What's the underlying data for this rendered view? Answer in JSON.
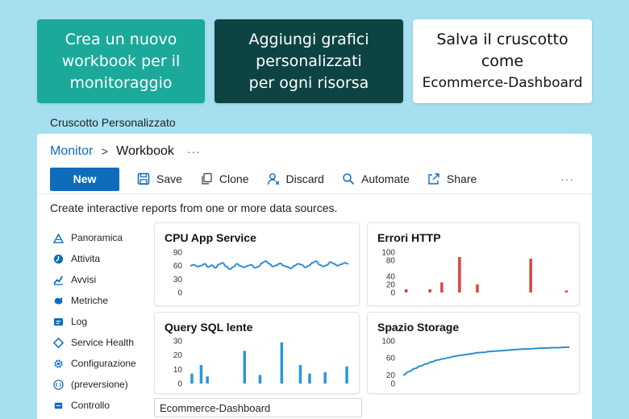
{
  "steps": [
    {
      "text": "Crea un nuovo\nworkbook per il\nmonitoraggio"
    },
    {
      "text": "Aggiungi grafici\npersonalizzati\nper ogni risorsa"
    },
    {
      "line1": "Salva il cruscotto",
      "line2": "come",
      "line3": "Ecommerce-Dashboard"
    }
  ],
  "section_caption": "Cruscotto Personalizzato",
  "breadcrumb": {
    "root": "Monitor",
    "separator": ">",
    "current": "Workbook",
    "more": "···"
  },
  "toolbar": {
    "new_label": "New",
    "save_label": "Save",
    "clone_label": "Clone",
    "discard_label": "Discard",
    "automate_label": "Automate",
    "share_label": "Share",
    "more": "···"
  },
  "intro_text": "Create interactive reports from one or more data sources.",
  "nav": {
    "items": [
      {
        "label": "Panoramica",
        "icon": "chart-icon"
      },
      {
        "label": "Attivita",
        "icon": "activity-icon"
      },
      {
        "label": "Avvisi",
        "icon": "bell-icon"
      },
      {
        "label": "Metriche",
        "icon": "metrics-icon"
      },
      {
        "label": "Log",
        "icon": "log-icon"
      },
      {
        "label": "Service Health",
        "icon": "health-icon"
      },
      {
        "label": "Configurazione",
        "icon": "gear-icon"
      },
      {
        "label": "(preversione)",
        "icon": "preview-icon"
      },
      {
        "label": "Controllo",
        "icon": "control-icon"
      }
    ]
  },
  "colors": {
    "line": "#2b8fd0",
    "bar_red": "#d9473a",
    "bar_blue": "#2e95dc",
    "accent": "#0f6cbd"
  },
  "chart_data": [
    {
      "type": "line",
      "title": "CPU App Service",
      "ylim": [
        0,
        90
      ],
      "yticks": [
        90,
        60,
        30,
        0
      ],
      "values": [
        60,
        62,
        58,
        60,
        64,
        57,
        61,
        55,
        63,
        66,
        58,
        52,
        57,
        64,
        59,
        56,
        60,
        62,
        55,
        58,
        66,
        70,
        64,
        58,
        61,
        65,
        60,
        57,
        54,
        60,
        64,
        62,
        56,
        60,
        66,
        70,
        62,
        58,
        61,
        68,
        64,
        60,
        63,
        66,
        64
      ]
    },
    {
      "type": "bar",
      "title": "Errori HTTP",
      "ylim": [
        0,
        100
      ],
      "yticks": [
        100,
        80,
        40,
        20,
        0
      ],
      "values": [
        8,
        0,
        0,
        0,
        8,
        0,
        25,
        0,
        0,
        88,
        0,
        0,
        20,
        0,
        0,
        0,
        0,
        0,
        0,
        0,
        0,
        84,
        0,
        0,
        0,
        0,
        0,
        5
      ]
    },
    {
      "type": "bar",
      "title": "Query SQL lente",
      "ylim": [
        0,
        30
      ],
      "yticks": [
        30,
        20,
        10,
        0
      ],
      "values": [
        7,
        0,
        0,
        13,
        0,
        5,
        0,
        0,
        0,
        0,
        0,
        0,
        0,
        0,
        0,
        0,
        0,
        23,
        0,
        0,
        0,
        0,
        6,
        0,
        0,
        0,
        0,
        0,
        0,
        29,
        0,
        0,
        0,
        0,
        0,
        13,
        0,
        0,
        7,
        0,
        0,
        0,
        0,
        8,
        0,
        0,
        0,
        0,
        0,
        0,
        12
      ]
    },
    {
      "type": "line",
      "title": "Spazio Storage",
      "ylim": [
        0,
        100
      ],
      "yticks": [
        100,
        60,
        20,
        0
      ],
      "values": [
        20,
        28,
        35,
        41,
        46,
        51,
        55,
        58,
        61,
        64,
        66,
        68,
        70,
        72,
        73,
        75,
        76,
        77,
        78,
        79,
        80,
        81,
        81,
        82,
        83,
        83,
        84,
        84,
        85,
        85
      ]
    }
  ],
  "name_field_value": "Ecommerce-Dashboard"
}
